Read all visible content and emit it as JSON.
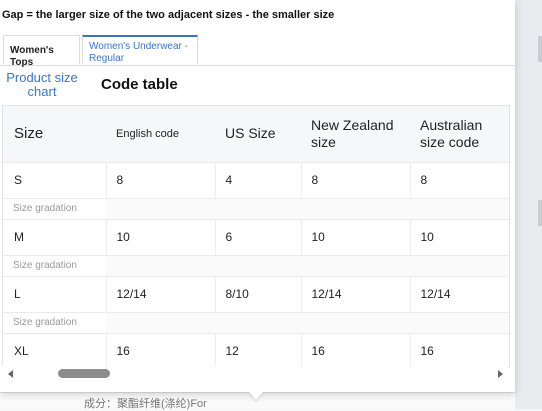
{
  "gap_note": "Gap = the larger size of the two adjacent sizes - the smaller size",
  "tabs": [
    {
      "label": "Women's Tops",
      "active": false
    },
    {
      "label": "Women's Underwear - Regular",
      "active": true
    }
  ],
  "subtabs": [
    {
      "label": "Product size chart",
      "active": true
    },
    {
      "label": "Code table",
      "active": false
    }
  ],
  "table": {
    "headers": [
      "Size",
      "English code",
      "US Size",
      "New Zealand size",
      "Australian size code"
    ],
    "gradation_label": "Size gradation",
    "rows": [
      {
        "size": "S",
        "english": "8",
        "us": "4",
        "nz": "8",
        "au": "8"
      },
      {
        "size": "M",
        "english": "10",
        "us": "6",
        "nz": "10",
        "au": "10"
      },
      {
        "size": "L",
        "english": "12/14",
        "us": "8/10",
        "nz": "12/14",
        "au": "12/14"
      },
      {
        "size": "XL",
        "english": "16",
        "us": "12",
        "nz": "16",
        "au": "16"
      }
    ]
  },
  "background_text": "成分：聚酯纤维(涤纶)For",
  "colors": {
    "accent": "#3a74c9",
    "header_bg": "#f6f7f9"
  },
  "icons": {
    "scroll_left": "triangle-left",
    "scroll_right": "triangle-right"
  }
}
